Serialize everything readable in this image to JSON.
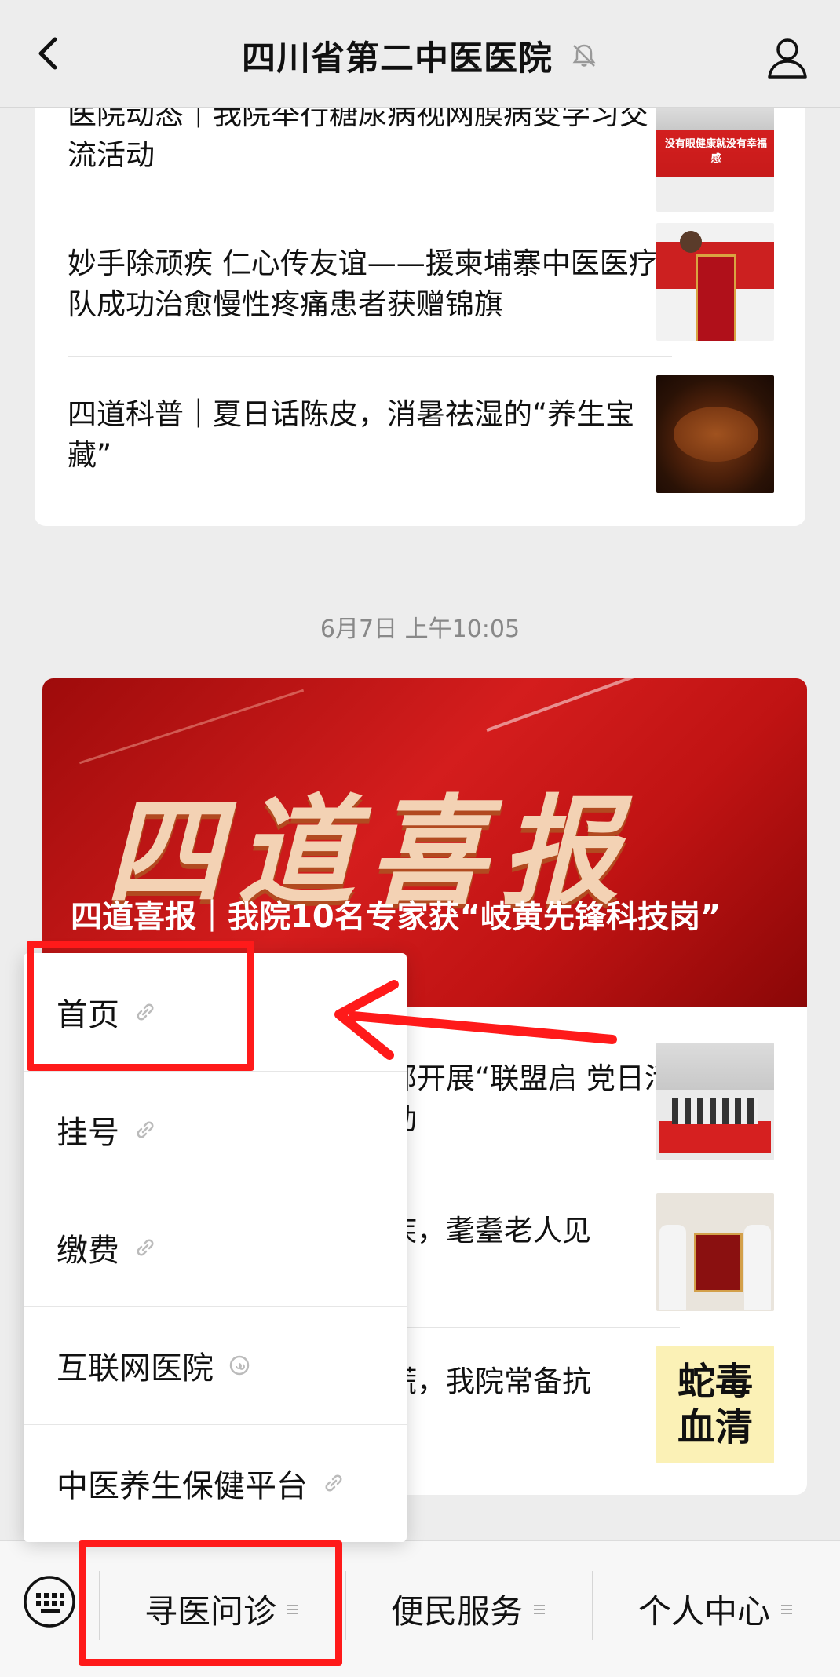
{
  "header": {
    "title": "四川省第二中医医院"
  },
  "card1": {
    "items": [
      {
        "title": "医院动态｜我院举行糖尿病视网膜病变学习交流活动",
        "thumb_text": "没有眼健康就没有幸福感"
      },
      {
        "title": "妙手除顽疾 仁心传友谊——援柬埔寨中医医疗队成功治愈慢性疼痛患者获赠锦旗"
      },
      {
        "title": "四道科普｜夏日话陈皮，消暑祛湿的“养生宝藏”"
      }
    ]
  },
  "timestamp": "6月7日 上午10:05",
  "card2": {
    "banner_art": "四道喜报",
    "banner_caption": "四道喜报｜我院10名专家获“岐黄先锋科技岗”",
    "items": [
      {
        "title": "部开展“联盟启 党日活动"
      },
      {
        "title": "疾，耄耋老人见"
      },
      {
        "title": "慌，我院常备抗",
        "thumb_text": "蛇毒 血清"
      }
    ]
  },
  "popup": {
    "items": [
      {
        "label": "首页"
      },
      {
        "label": "挂号"
      },
      {
        "label": "缴费"
      },
      {
        "label": "互联网医院"
      },
      {
        "label": "中医养生保健平台"
      }
    ]
  },
  "bottombar": {
    "tabs": [
      {
        "label": "寻医问诊"
      },
      {
        "label": "便民服务"
      },
      {
        "label": "个人中心"
      }
    ]
  },
  "colors": {
    "highlight": "#ff1a1a",
    "banner": "#c01313"
  }
}
